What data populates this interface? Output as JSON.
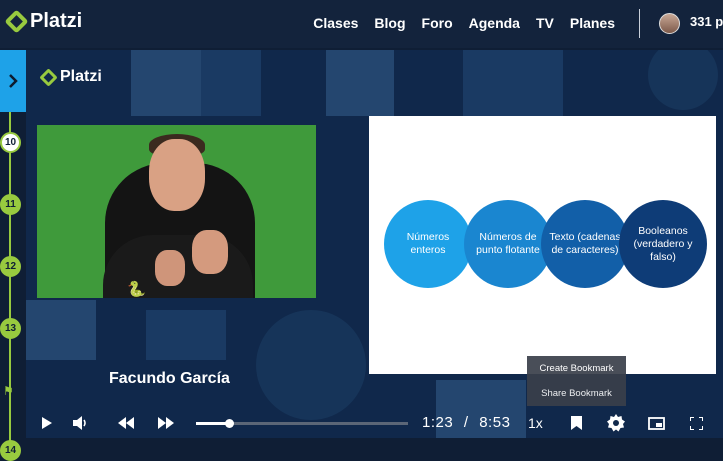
{
  "header": {
    "logo_text": "Platzi",
    "nav": [
      "Clases",
      "Blog",
      "Foro",
      "Agenda",
      "TV",
      "Planes"
    ],
    "points": "331 p"
  },
  "sidebar": {
    "toggle_icon": "chevron-right-icon",
    "timeline": [
      "10",
      "11",
      "12",
      "13",
      "14"
    ],
    "active_item": "10"
  },
  "video": {
    "watermark": "Platzi",
    "presenter_name": "Facundo García",
    "slide": {
      "circles": [
        {
          "label": "Números enteros",
          "color": "#1ea2e8"
        },
        {
          "label": "Números de punto flotante",
          "color": "#1a86d0"
        },
        {
          "label": "Texto (cadenas de caracteres)",
          "color": "#125fa8"
        },
        {
          "label": "Booleanos (verdadero y falso)",
          "color": "#0e3c77"
        }
      ]
    },
    "bookmark_menu": {
      "create": "Create Bookmark",
      "share": "Share Bookmark"
    }
  },
  "player": {
    "current_time": "1:23",
    "separator": "/",
    "duration": "8:53",
    "speed": "1x",
    "progress_fraction": 0.156,
    "icons": [
      "play-icon",
      "volume-icon",
      "rewind-icon",
      "forward-icon",
      "bookmark-icon",
      "settings-icon",
      "pip-icon",
      "fullscreen-icon"
    ]
  },
  "colors": {
    "accent_green": "#98ca3f",
    "accent_blue": "#1ea2e8",
    "header_bg": "#13233c"
  }
}
